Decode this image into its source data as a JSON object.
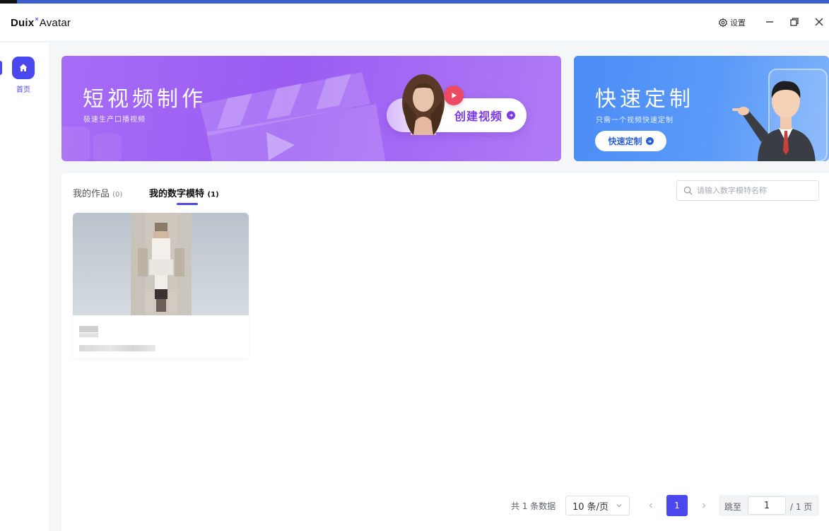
{
  "app": {
    "brand_main": "Duix",
    "brand_sup": "×",
    "brand_rest": "Avatar",
    "settings_label": "设置"
  },
  "sidebar": {
    "items": [
      {
        "label": "首页",
        "icon": "home-icon",
        "active": true
      }
    ]
  },
  "banners": {
    "short_video": {
      "title": "短视频制作",
      "subtitle": "极速生产口播视频",
      "button": "创建视频"
    },
    "quick_custom": {
      "title": "快速定制",
      "subtitle": "只需一个视频快速定制",
      "button": "快速定制"
    }
  },
  "tabs": [
    {
      "label": "我的作品",
      "count": "(0)",
      "active": false
    },
    {
      "label": "我的数字模特",
      "count": "(1)",
      "active": true
    }
  ],
  "search": {
    "placeholder": "请输入数字模特名称",
    "value": ""
  },
  "pagination": {
    "total_text": "共 1 条数据",
    "page_size": "10 条/页",
    "current_page": "1",
    "jump_label": "跳至",
    "jump_value": "1",
    "total_pages_text": "/ 1 页"
  },
  "colors": {
    "accent": "#4b47ee",
    "banner_purple": "#9b5cf2",
    "banner_blue": "#4b8cf6",
    "create_button_text": "#7c3ae8",
    "custom_button_text": "#2d5fd6"
  }
}
